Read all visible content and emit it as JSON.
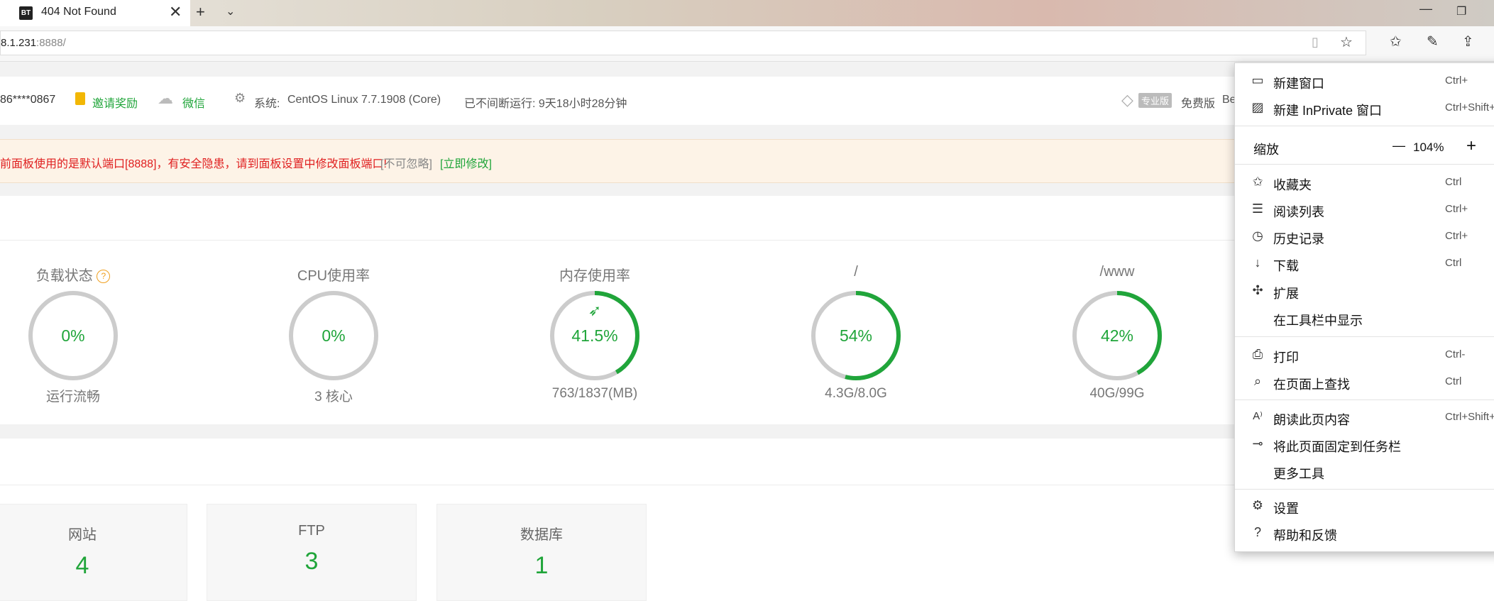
{
  "browser": {
    "tab_title": "404 Not Found",
    "tab_favicon": "BT",
    "url_host": "8.1.231",
    "url_port_path": ":8888/"
  },
  "infobar": {
    "user": "86****0867",
    "invite": "邀请奖励",
    "wechat": "微信",
    "system_label": "系统:",
    "system_value": "CentOS Linux 7.7.1908 (Core)",
    "uptime": "已不间断运行: 9天18小时28分钟",
    "pro_badge": "专业版",
    "free_label": "免费版",
    "be_fragment": "Be"
  },
  "warning": {
    "text": "前面板使用的是默认端口[8888]，有安全隐患，请到面板设置中修改面板端口!",
    "ignore": "[不可忽略]",
    "fix": "[立即修改]"
  },
  "gauges": [
    {
      "title": "负载状态",
      "value_text": "0%",
      "percent": 0,
      "sub": "运行流畅",
      "help": "?"
    },
    {
      "title": "CPU使用率",
      "value_text": "0%",
      "percent": 0,
      "sub": "3 核心"
    },
    {
      "title": "内存使用率",
      "value_text": "41.5%",
      "percent": 41.5,
      "sub": "763/1837(MB)"
    },
    {
      "title": "/",
      "value_text": "54%",
      "percent": 54,
      "sub": "4.3G/8.0G"
    },
    {
      "title": "/www",
      "value_text": "42%",
      "percent": 42,
      "sub": "40G/99G"
    }
  ],
  "counts": [
    {
      "label": "网站",
      "value": "4"
    },
    {
      "label": "FTP",
      "value": "3"
    },
    {
      "label": "数据库",
      "value": "1"
    }
  ],
  "menu": {
    "new_window": "新建窗口",
    "new_window_sc": "Ctrl+",
    "new_inprivate": "新建 InPrivate 窗口",
    "new_inprivate_sc": "Ctrl+Shift+",
    "zoom_label": "缩放",
    "zoom_minus": "—",
    "zoom_value": "104%",
    "zoom_plus": "+",
    "favorites": "收藏夹",
    "favorites_sc": "Ctrl",
    "reading_list": "阅读列表",
    "reading_list_sc": "Ctrl+",
    "history": "历史记录",
    "history_sc": "Ctrl+",
    "downloads": "下载",
    "downloads_sc": "Ctrl",
    "extensions": "扩展",
    "show_in_toolbar": "在工具栏中显示",
    "print": "打印",
    "print_sc": "Ctrl-",
    "find": "在页面上查找",
    "find_sc": "Ctrl",
    "read_aloud": "朗读此页内容",
    "read_aloud_sc": "Ctrl+Shift+",
    "pin_taskbar": "将此页面固定到任务栏",
    "more_tools": "更多工具",
    "settings": "设置",
    "help": "帮助和反馈"
  },
  "colors": {
    "accent_green": "#20a53a",
    "warning_red": "#e01f1f",
    "gauge_track": "#cccccc"
  }
}
